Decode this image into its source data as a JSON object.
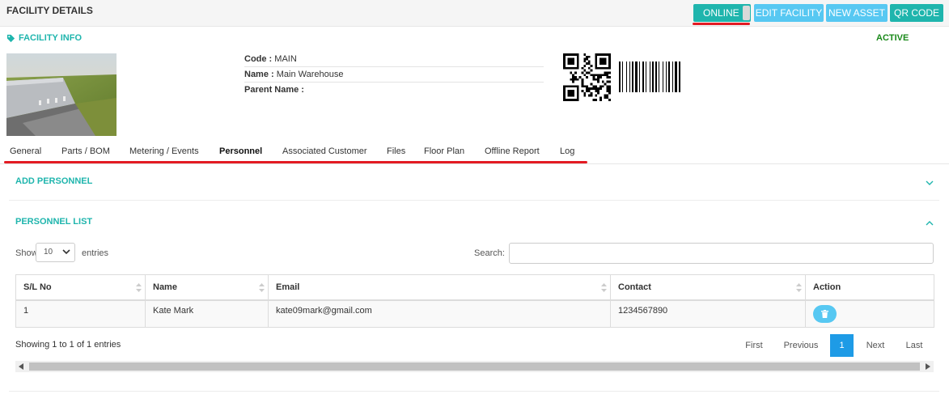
{
  "header": {
    "title": "FACILITY DETAILS",
    "buttons": {
      "online": "ONLINE",
      "edit_facility": "EDIT FACILITY",
      "new_asset": "NEW ASSET",
      "qr_code": "QR CODE"
    }
  },
  "facility_info": {
    "section_title": "FACILITY INFO",
    "status": "ACTIVE",
    "fields": [
      {
        "label": "Code :",
        "value": "MAIN"
      },
      {
        "label": "Name :",
        "value": "Main Warehouse"
      },
      {
        "label": "Parent Name :",
        "value": ""
      }
    ]
  },
  "tabs": [
    "General",
    "Parts / BOM",
    "Metering / Events",
    "Personnel",
    "Associated Customer",
    "Files",
    "Floor Plan",
    "Offline Report",
    "Log"
  ],
  "active_tab": "Personnel",
  "panels": {
    "add_personnel": "ADD PERSONNEL",
    "personnel_list": "PERSONNEL LIST"
  },
  "table_controls": {
    "show_label": "Show",
    "entries_value": "10",
    "entries_label": "entries",
    "search_label": "Search:",
    "search_value": ""
  },
  "table": {
    "columns": [
      "S/L No",
      "Name",
      "Email",
      "Contact",
      "Action"
    ],
    "rows": [
      {
        "sl": "1",
        "name": "Kate Mark",
        "email": "kate09mark@gmail.com",
        "contact": "1234567890"
      }
    ]
  },
  "footer": {
    "showing": "Showing 1 to 1 of 1 entries",
    "pagination": {
      "first": "First",
      "previous": "Previous",
      "current": "1",
      "next": "Next",
      "last": "Last"
    }
  },
  "colors": {
    "teal": "#1fb5ad",
    "light_blue": "#57c8f2",
    "page_blue": "#1e9be6",
    "active_green": "#1a8a1a",
    "annotation_red": "#e31b23"
  },
  "icons": [
    "tag-icon",
    "chevron-down-icon",
    "chevron-up-icon",
    "sort-icon",
    "trash-icon",
    "qr-code-icon",
    "barcode-icon"
  ]
}
